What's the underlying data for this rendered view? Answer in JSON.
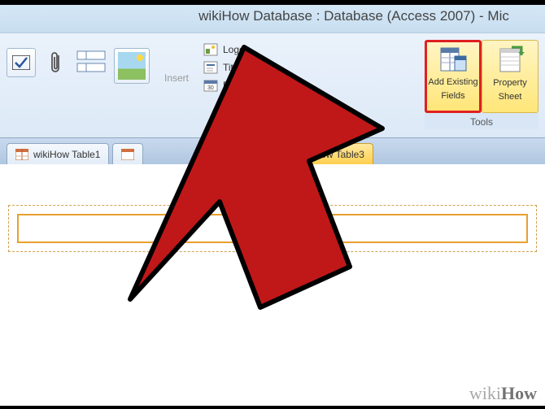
{
  "title": "wikiHow Database : Database (Access 2007)  -  Mic",
  "ribbon": {
    "insert_label": "Insert",
    "logo_label": "Logo",
    "title_label": "Title",
    "datetime_label": "Date and Time"
  },
  "tools": {
    "group_label": "Tools",
    "add_fields": {
      "line1": "Add Existing",
      "line2": "Fields"
    },
    "property_sheet": {
      "line1": "Property",
      "line2": "Sheet"
    }
  },
  "tabs": {
    "tab1": "wikiHow Table1",
    "tab3": "How Table3"
  },
  "watermark": {
    "prefix": "wiki",
    "suffix": "How"
  }
}
